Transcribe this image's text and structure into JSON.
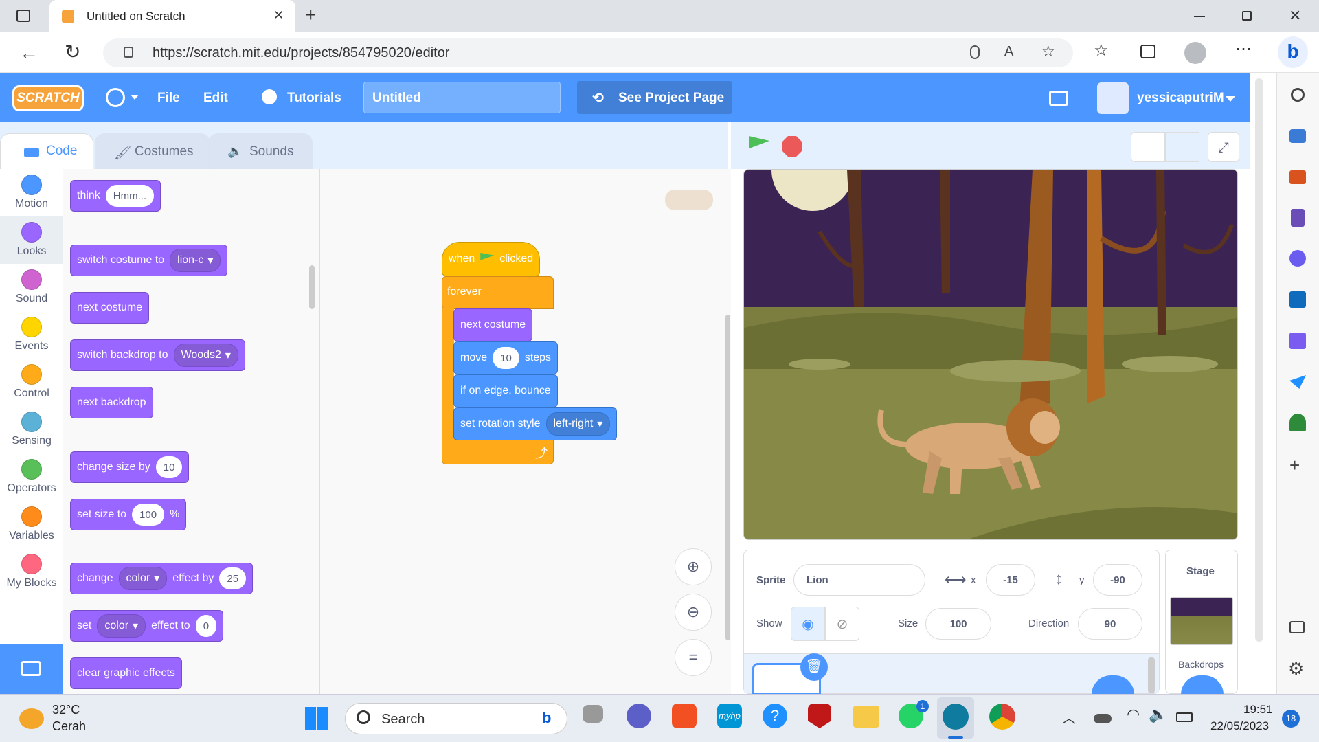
{
  "browser": {
    "tab_title": "Untitled on Scratch",
    "url_text": "https://scratch.mit.edu/projects/854795020/editor",
    "new_tab_symbol": "+",
    "close_tab_symbol": "✕"
  },
  "menubar": {
    "logo": "SCRATCH",
    "file": "File",
    "edit": "Edit",
    "tutorials": "Tutorials",
    "project_title": "Untitled",
    "see_project_page": "See Project Page",
    "username": "yessicaputriM"
  },
  "editor_tabs": {
    "code": "Code",
    "costumes": "Costumes",
    "sounds": "Sounds"
  },
  "categories": [
    {
      "label": "Motion",
      "color": "#4c97ff"
    },
    {
      "label": "Looks",
      "color": "#9966ff"
    },
    {
      "label": "Sound",
      "color": "#cf63cf"
    },
    {
      "label": "Events",
      "color": "#ffd500"
    },
    {
      "label": "Control",
      "color": "#ffab19"
    },
    {
      "label": "Sensing",
      "color": "#5cb1d6"
    },
    {
      "label": "Operators",
      "color": "#59c059"
    },
    {
      "label": "Variables",
      "color": "#ff8c1a"
    },
    {
      "label": "My Blocks",
      "color": "#ff6680"
    }
  ],
  "palette": {
    "think": "think",
    "think_value": "Hmm...",
    "switch_costume": "switch costume to",
    "costume_value": "lion-c",
    "next_costume": "next costume",
    "switch_backdrop": "switch backdrop to",
    "backdrop_value": "Woods2",
    "next_backdrop": "next backdrop",
    "change_size": "change size by",
    "change_size_value": "10",
    "set_size": "set size to",
    "set_size_value": "100",
    "set_size_unit": "%",
    "change_effect": "change",
    "effect_name": "color",
    "effect_by": "effect by",
    "effect_by_value": "25",
    "set_effect": "set",
    "set_effect_name": "color",
    "effect_to": "effect to",
    "effect_to_value": "0",
    "clear_effects": "clear graphic effects"
  },
  "script": {
    "when": "when",
    "clicked": "clicked",
    "forever": "forever",
    "next_costume": "next costume",
    "move": "move",
    "move_value": "10",
    "steps": "steps",
    "bounce": "if on edge, bounce",
    "rotation": "set rotation style",
    "rotation_value": "left-right"
  },
  "sprite_info": {
    "sprite_label": "Sprite",
    "sprite_name": "Lion",
    "x_label": "x",
    "x_value": "-15",
    "y_label": "y",
    "y_value": "-90",
    "show_label": "Show",
    "size_label": "Size",
    "size_value": "100",
    "direction_label": "Direction",
    "direction_value": "90"
  },
  "stage_pane": {
    "title": "Stage",
    "backdrops": "Backdrops"
  },
  "taskbar": {
    "temperature": "32°C",
    "weather": "Cerah",
    "search": "Search",
    "time": "19:51",
    "date": "22/05/2023",
    "notifications": "18",
    "whatsapp_badge": "1",
    "myhp": "myhp"
  }
}
